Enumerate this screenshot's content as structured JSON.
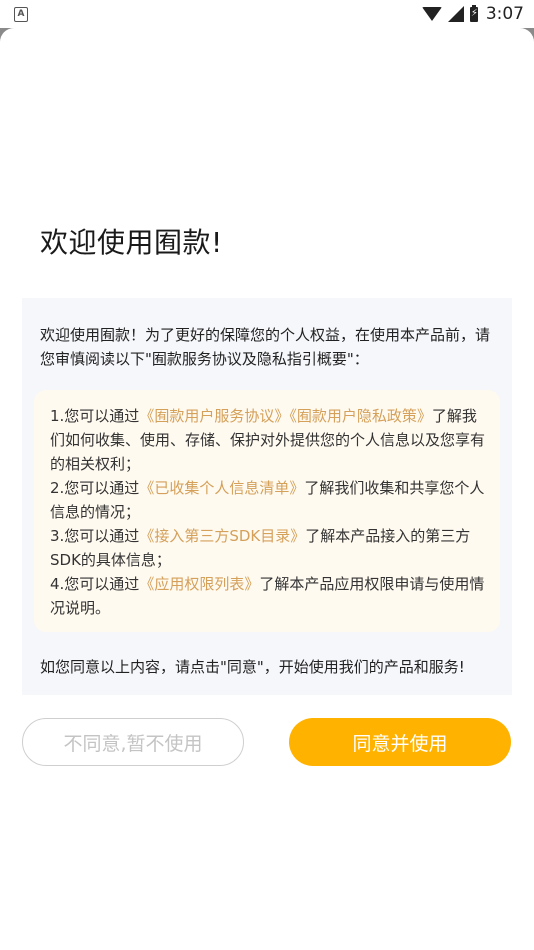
{
  "status_bar": {
    "left_icon": "A",
    "time": "3:07",
    "icons": [
      "wifi-icon",
      "signal-icon",
      "battery-icon"
    ]
  },
  "dialog": {
    "title": "欢迎使用囿款!",
    "intro": "欢迎使用囿款！为了更好的保障您的个人权益，在使用本产品前，请您审慎阅读以下\"囿款服务协议及隐私指引概要\"：",
    "items": [
      {
        "prefix": "1.您可以通过",
        "links": [
          "《囿款用户服务协议》",
          "《囿款用户隐私政策》"
        ],
        "suffix": "了解我们如何收集、使用、存储、保护对外提供您的个人信息以及您享有的相关权利；"
      },
      {
        "prefix": "2.您可以通过",
        "links": [
          "《已收集个人信息清单》"
        ],
        "suffix": "了解我们收集和共享您个人信息的情况；"
      },
      {
        "prefix": "3.您可以通过",
        "links": [
          "《接入第三方SDK目录》"
        ],
        "suffix": "了解本产品接入的第三方SDK的具体信息；"
      },
      {
        "prefix": "4.您可以通过",
        "links": [
          "《应用权限列表》"
        ],
        "suffix": "了解本产品应用权限申请与使用情况说明。"
      }
    ],
    "footer": "如您同意以上内容，请点击\"同意\"，开始使用我们的产品和服务!",
    "buttons": {
      "disagree": "不同意,暂不使用",
      "agree": "同意并使用"
    }
  },
  "colors": {
    "accent": "#ffb300",
    "link": "#d4a05a",
    "panel_bg": "#f6f7fb",
    "inner_bg": "#fffaf0"
  }
}
